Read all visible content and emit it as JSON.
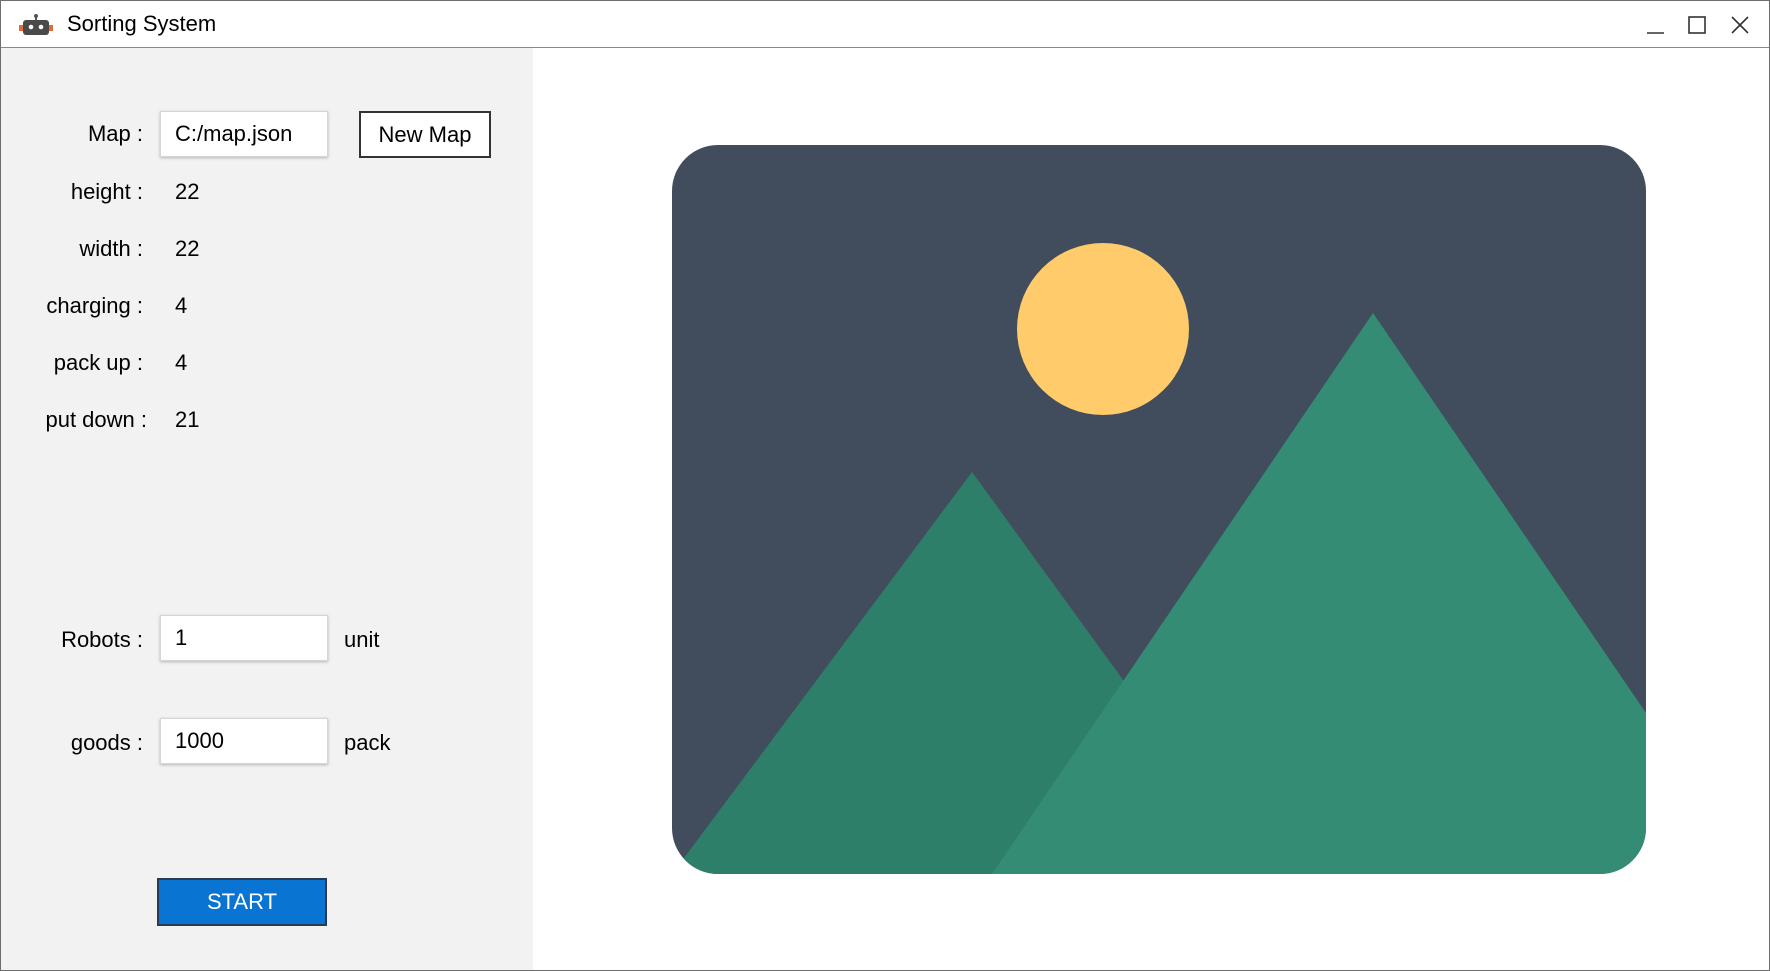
{
  "window": {
    "title": "Sorting System",
    "app_icon": "robot-icon",
    "controls": {
      "minimize": "minimize-icon",
      "maximize": "maximize-icon",
      "close": "close-icon"
    }
  },
  "map_panel": {
    "map_label": "Map :",
    "map_path_value": "C:/map.json",
    "new_map_button": "New Map",
    "stats": [
      {
        "label": "height :",
        "value": "22"
      },
      {
        "label": "width :",
        "value": "22"
      },
      {
        "label": "charging :",
        "value": "4"
      },
      {
        "label": "pack up :",
        "value": "4"
      },
      {
        "label": "put down :",
        "value": "21"
      }
    ]
  },
  "settings": {
    "robots_label": "Robots :",
    "robots_value": "1",
    "robots_unit": "unit",
    "goods_label": "goods :",
    "goods_value": "1000",
    "goods_unit": "pack"
  },
  "start_button": "START",
  "preview": {
    "icon": "image-placeholder-icon",
    "colors": {
      "sky": "#414d5c",
      "sun": "#ffcb6b",
      "mountain_back": "#2e7f6a",
      "mountain_front": "#348c74"
    }
  },
  "colors": {
    "sidebar_bg": "#f2f2f2",
    "start_button_bg": "#0a74d2"
  }
}
